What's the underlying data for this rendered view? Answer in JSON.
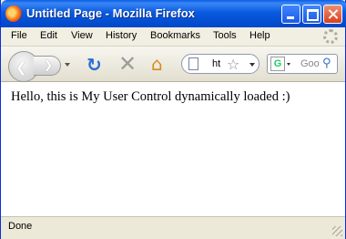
{
  "window": {
    "title": "Untitled Page - Mozilla Firefox"
  },
  "menubar": {
    "items": [
      "File",
      "Edit",
      "View",
      "History",
      "Bookmarks",
      "Tools",
      "Help"
    ]
  },
  "navbar": {
    "back_icon": "back-arrow-icon",
    "forward_icon": "forward-arrow-icon",
    "reload_icon": "reload-icon",
    "stop_icon": "stop-icon",
    "home_icon": "home-icon",
    "url_value": "ht",
    "search_engine_letter": "G",
    "search_placeholder": "Goo"
  },
  "content": {
    "text": "Hello, this is My User Control dynamically loaded :)"
  },
  "statusbar": {
    "text": "Done"
  }
}
